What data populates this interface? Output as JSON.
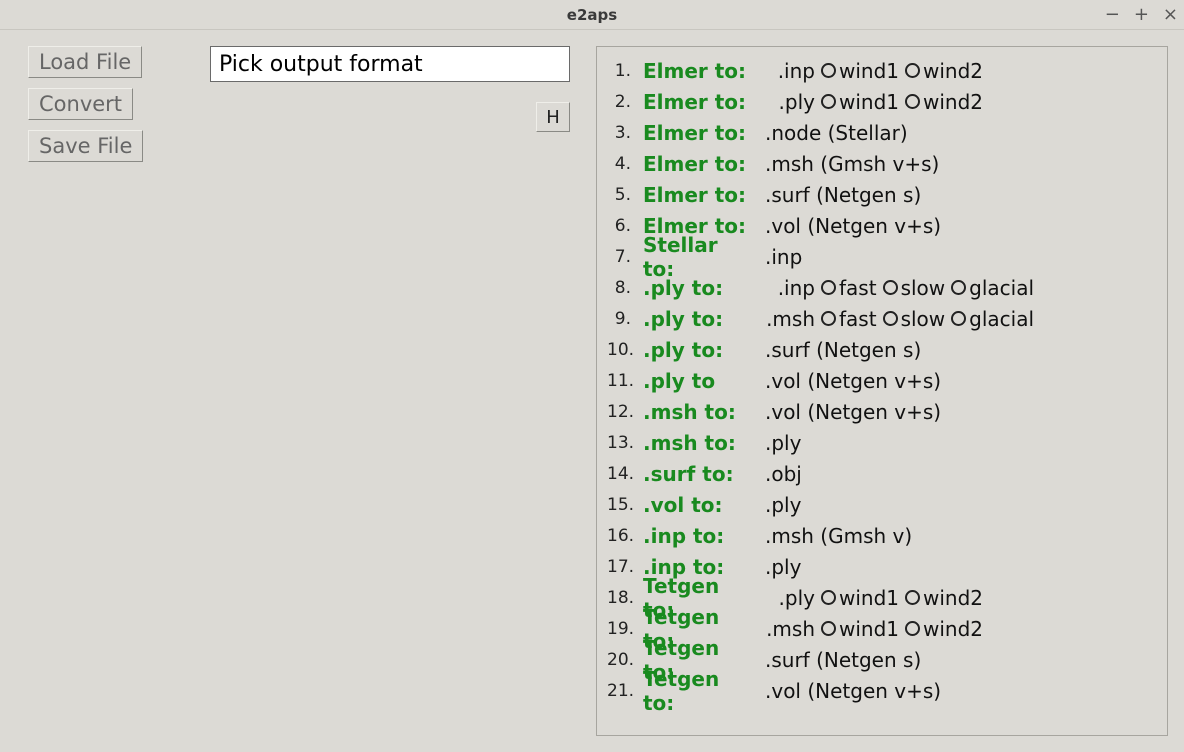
{
  "window": {
    "title": "e2aps",
    "controls": {
      "min": "−",
      "max": "+",
      "close": "×"
    }
  },
  "buttons": {
    "load": "Load File",
    "convert": "Convert",
    "save": "Save File",
    "h": "H"
  },
  "input": {
    "placeholder": "Pick output format",
    "value": "Pick output format"
  },
  "rows": [
    {
      "n": "1.",
      "src": "Elmer to:",
      "mode": "multi",
      "ext": ".inp",
      "opts": [
        "wind1",
        "wind2"
      ]
    },
    {
      "n": "2.",
      "src": "Elmer to:",
      "mode": "multi",
      "ext": ".ply",
      "opts": [
        "wind1",
        "wind2"
      ]
    },
    {
      "n": "3.",
      "src": "Elmer to:",
      "mode": "single",
      "ext": ".node (Stellar)"
    },
    {
      "n": "4.",
      "src": "Elmer to:",
      "mode": "single",
      "ext": ".msh (Gmsh v+s)"
    },
    {
      "n": "5.",
      "src": "Elmer to:",
      "mode": "single",
      "ext": ".surf (Netgen s)"
    },
    {
      "n": "6.",
      "src": "Elmer to:",
      "mode": "single",
      "ext": ".vol (Netgen v+s)"
    },
    {
      "n": "7.",
      "src": "Stellar to:",
      "mode": "single",
      "ext": ".inp"
    },
    {
      "n": "8.",
      "src": ".ply to:",
      "mode": "multi",
      "ext": ".inp",
      "opts": [
        "fast",
        "slow",
        "glacial"
      ]
    },
    {
      "n": "9.",
      "src": ".ply to:",
      "mode": "multi",
      "ext": ".msh",
      "opts": [
        "fast",
        "slow",
        "glacial"
      ]
    },
    {
      "n": "10.",
      "src": ".ply to:",
      "mode": "single",
      "ext": ".surf (Netgen s)"
    },
    {
      "n": "11.",
      "src": ".ply to",
      "mode": "single",
      "ext": ".vol (Netgen v+s)"
    },
    {
      "n": "12.",
      "src": ".msh to:",
      "mode": "single",
      "ext": ".vol (Netgen v+s)"
    },
    {
      "n": "13.",
      "src": ".msh to:",
      "mode": "single",
      "ext": ".ply"
    },
    {
      "n": "14.",
      "src": ".surf to:",
      "mode": "single",
      "ext": ".obj"
    },
    {
      "n": "15.",
      "src": ".vol to:",
      "mode": "single",
      "ext": ".ply"
    },
    {
      "n": "16.",
      "src": ".inp to:",
      "mode": "single",
      "ext": ".msh (Gmsh v)"
    },
    {
      "n": "17.",
      "src": ".inp to:",
      "mode": "single",
      "ext": ".ply"
    },
    {
      "n": "18.",
      "src": "Tetgen to:",
      "mode": "multi",
      "ext": ".ply",
      "opts": [
        "wind1",
        "wind2"
      ]
    },
    {
      "n": "19.",
      "src": "Tetgen to:",
      "mode": "multi",
      "ext": ".msh",
      "opts": [
        "wind1",
        "wind2"
      ]
    },
    {
      "n": "20.",
      "src": "Tetgen to:",
      "mode": "single",
      "ext": ".surf (Netgen s)"
    },
    {
      "n": "21.",
      "src": "Tetgen to:",
      "mode": "single",
      "ext": ".vol (Netgen v+s)"
    }
  ]
}
